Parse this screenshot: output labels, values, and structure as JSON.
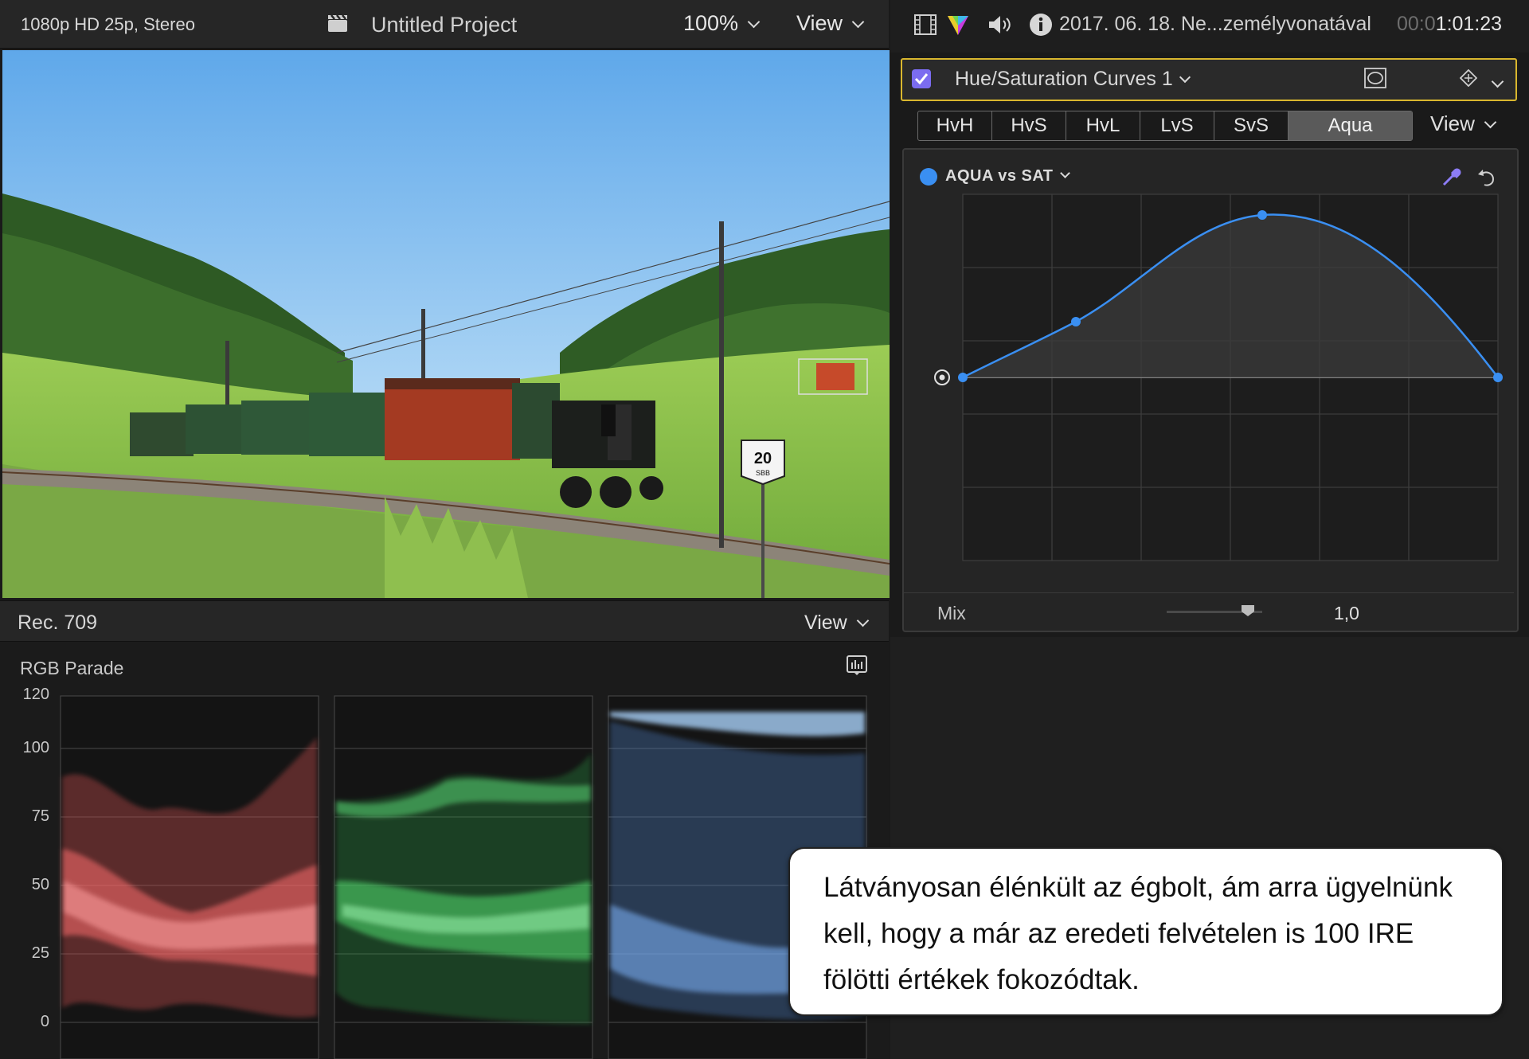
{
  "viewer": {
    "format": "1080p HD 25p, Stereo",
    "project_title": "Untitled Project",
    "zoom": "100%",
    "view_label": "View"
  },
  "scopes": {
    "standard": "Rec. 709",
    "view_label": "View",
    "scope_type": "RGB Parade",
    "ticks": [
      "120",
      "100",
      "75",
      "50",
      "25",
      "0"
    ]
  },
  "inspector": {
    "clip_name": "2017. 06. 18. Ne...zemélyvonatával",
    "timecode_dim": "00:0",
    "timecode": "1:01:23",
    "effect_name": "Hue/Saturation Curves 1",
    "tabs": [
      {
        "label": "HvH",
        "active": false
      },
      {
        "label": "HvS",
        "active": false
      },
      {
        "label": "HvL",
        "active": false
      },
      {
        "label": "LvS",
        "active": false
      },
      {
        "label": "SvS",
        "active": false
      },
      {
        "label": "Aqua",
        "active": true
      }
    ],
    "tabs_view_label": "View",
    "curve_name": "AQUA vs SAT",
    "mix_label": "Mix",
    "mix_value": "1,0",
    "mix_level": 0.85,
    "curve_color": "#3a8ff2"
  },
  "callout": {
    "text": "Látványosan élénkült az égbolt, ám arra ügyelnünk kell, hogy a már az eredeti felvételen is 100 IRE fölötti értékek fokozódtak."
  },
  "overlay": {
    "speed_sign": "20",
    "speed_sign_sub": "SBB"
  }
}
